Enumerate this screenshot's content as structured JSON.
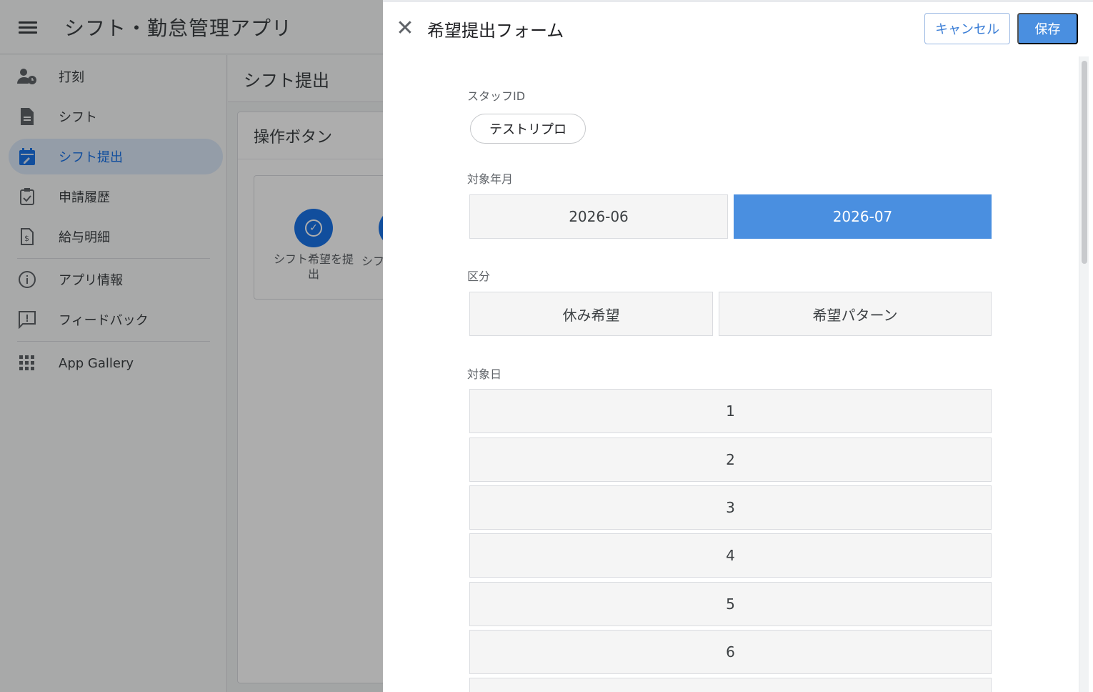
{
  "app": {
    "title": "シフト・勤怠管理アプリ",
    "sidebar": {
      "items": [
        {
          "label": "打刻",
          "icon": "person-clock-icon"
        },
        {
          "label": "シフト",
          "icon": "document-icon"
        },
        {
          "label": "シフト提出",
          "icon": "calendar-edit-icon",
          "active": true
        },
        {
          "label": "申請履歴",
          "icon": "clipboard-check-icon"
        },
        {
          "label": "給与明細",
          "icon": "receipt-icon"
        },
        {
          "label": "アプリ情報",
          "icon": "info-icon"
        },
        {
          "label": "フィードバック",
          "icon": "feedback-icon"
        },
        {
          "label": "App Gallery",
          "icon": "grid-icon"
        }
      ]
    },
    "content": {
      "page_title": "シフト提出",
      "card_title": "操作ボタン",
      "action_label_1": "シフト希望を提出",
      "action_label_2": "シフ"
    }
  },
  "dialog": {
    "title": "希望提出フォーム",
    "cancel_label": "キャンセル",
    "save_label": "保存",
    "staff_id": {
      "label": "スタッフID",
      "value": "テストリプロ"
    },
    "target_month": {
      "label": "対象年月",
      "options": [
        "2026-06",
        "2026-07"
      ],
      "selected": "2026-07"
    },
    "category": {
      "label": "区分",
      "options": [
        "休み希望",
        "希望パターン"
      ]
    },
    "target_day": {
      "label": "対象日",
      "options": [
        "1",
        "2",
        "3",
        "4",
        "5",
        "6"
      ]
    }
  },
  "colors": {
    "accent": "#4a8fe0",
    "brand_blue": "#1a73e8"
  }
}
